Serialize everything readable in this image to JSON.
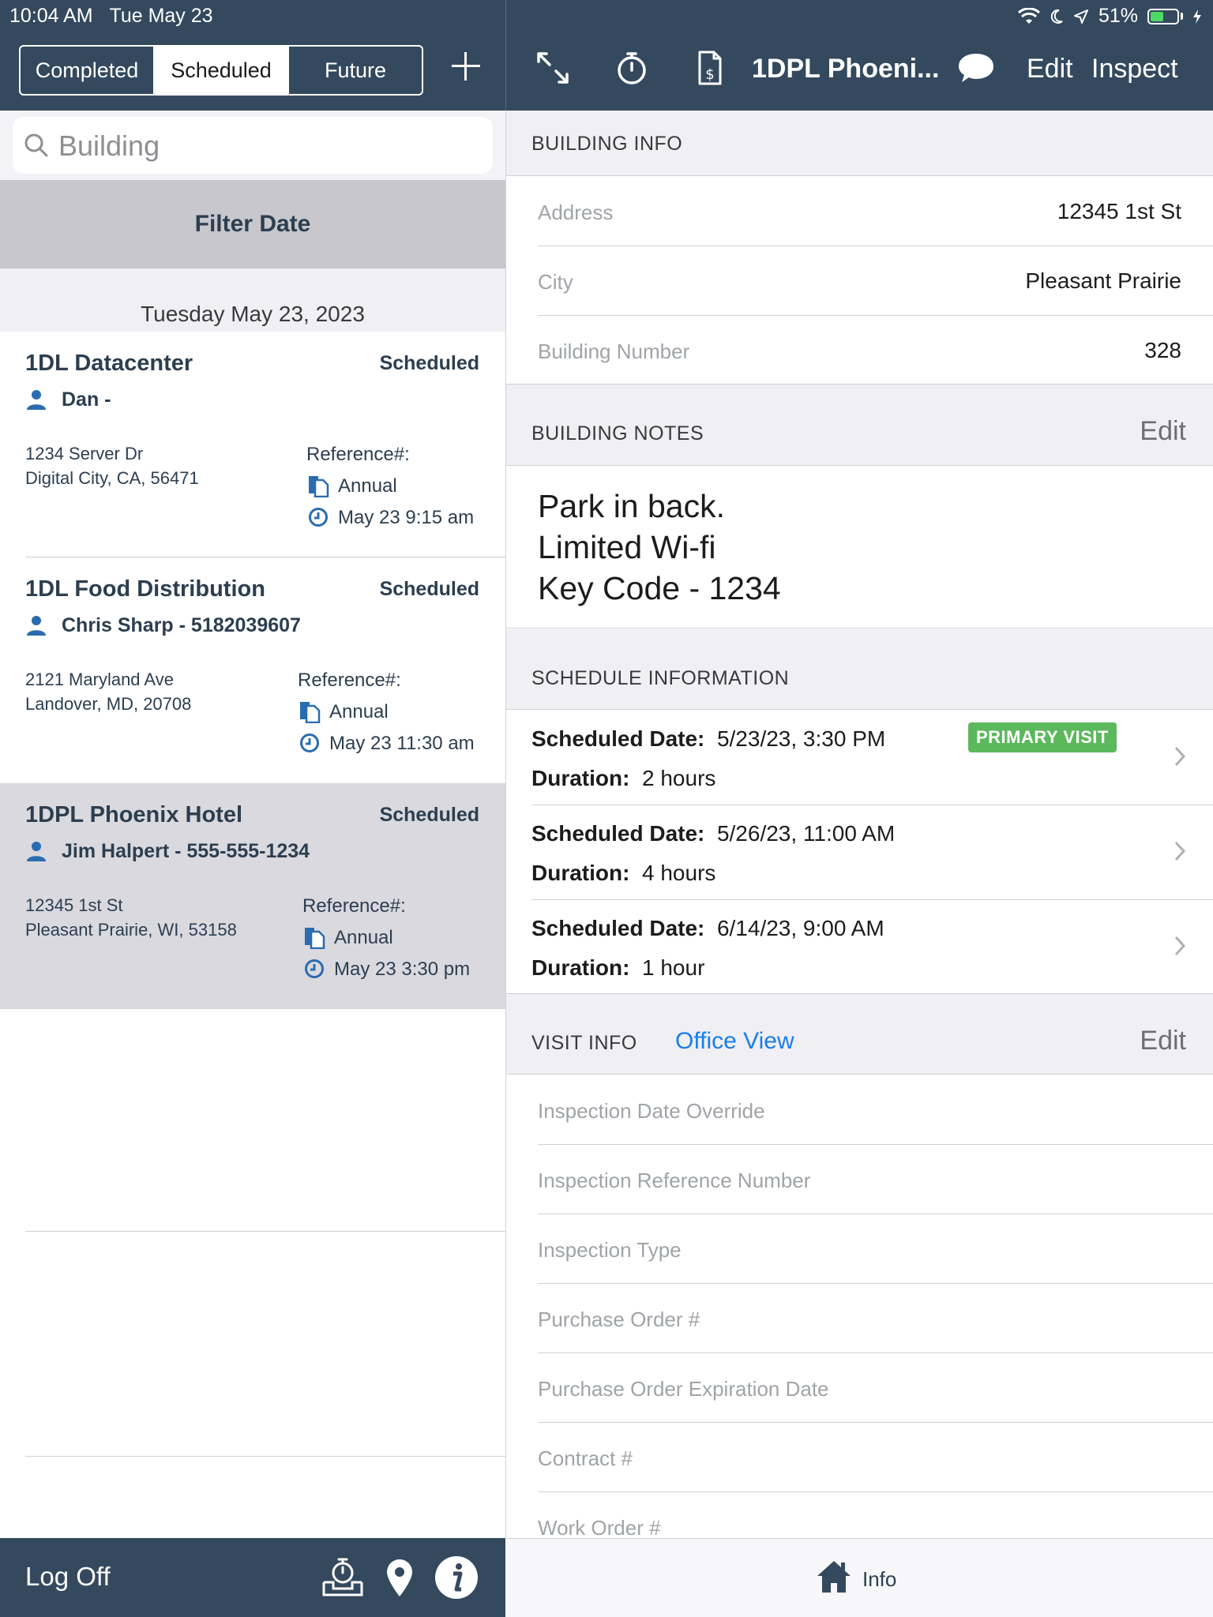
{
  "status_bar": {
    "time": "10:04 AM",
    "date": "Tue May 23",
    "battery": "51%",
    "battery_level": 0.51
  },
  "segments": [
    {
      "label": "Completed",
      "active": false
    },
    {
      "label": "Scheduled",
      "active": true
    },
    {
      "label": "Future",
      "active": false
    }
  ],
  "nav": {
    "title": "1DPL Phoeni...",
    "edit_label": "Edit",
    "inspect_label": "Inspect"
  },
  "search": {
    "placeholder": "Building"
  },
  "filter": {
    "label": "Filter Date"
  },
  "date_header": "Tuesday May 23, 2023",
  "jobs": [
    {
      "title": "1DL Datacenter",
      "status": "Scheduled",
      "contact": "Dan -",
      "address_line1": "1234 Server Dr",
      "address_line2": "Digital City, CA, 56471",
      "ref_label": "Reference#:",
      "type": "Annual",
      "time": "May 23 9:15 am",
      "selected": false
    },
    {
      "title": "1DL Food Distribution",
      "status": "Scheduled",
      "contact": "Chris Sharp - 5182039607",
      "address_line1": "2121 Maryland Ave",
      "address_line2": "Landover, MD, 20708",
      "ref_label": "Reference#:",
      "type": "Annual",
      "time": "May 23 11:30 am",
      "selected": false
    },
    {
      "title": "1DPL Phoenix Hotel",
      "status": "Scheduled",
      "contact": "Jim Halpert - 555-555-1234",
      "address_line1": "12345 1st St",
      "address_line2": "Pleasant Prairie, WI, 53158",
      "ref_label": "Reference#:",
      "type": "Annual",
      "time": "May 23 3:30 pm",
      "selected": true
    }
  ],
  "left_footer": {
    "logoff_label": "Log Off"
  },
  "building_info": {
    "header": "BUILDING INFO",
    "rows": [
      {
        "label": "Address",
        "value": "12345 1st St"
      },
      {
        "label": "City",
        "value": "Pleasant Prairie"
      },
      {
        "label": "Building Number",
        "value": "328"
      }
    ]
  },
  "building_notes": {
    "header": "BUILDING NOTES",
    "edit_label": "Edit",
    "lines": [
      "Park in back.",
      "Limited Wi-fi",
      "Key Code - 1234"
    ]
  },
  "schedule_info": {
    "header": "SCHEDULE INFORMATION",
    "date_label": "Scheduled Date:",
    "duration_label": "Duration:",
    "badge": "PRIMARY VISIT",
    "items": [
      {
        "date": "5/23/23, 3:30 PM",
        "duration": "2 hours"
      },
      {
        "date": "5/26/23, 11:00 AM",
        "duration": "4 hours"
      },
      {
        "date": "6/14/23, 9:00 AM",
        "duration": "1 hour"
      }
    ]
  },
  "visit_info": {
    "header": "VISIT INFO",
    "office_view_label": "Office View",
    "edit_label": "Edit",
    "fields": [
      "Inspection Date Override",
      "Inspection Reference Number",
      "Inspection Type",
      "Purchase Order #",
      "Purchase Order Expiration Date",
      "Contract #",
      "Work Order #"
    ]
  },
  "right_footer": {
    "info_label": "Info"
  },
  "colors": {
    "nav_bg": "#34495e",
    "accent_blue": "#1a7fe8",
    "badge_green": "#5cb85c",
    "icon_blue": "#2a6cb0"
  }
}
